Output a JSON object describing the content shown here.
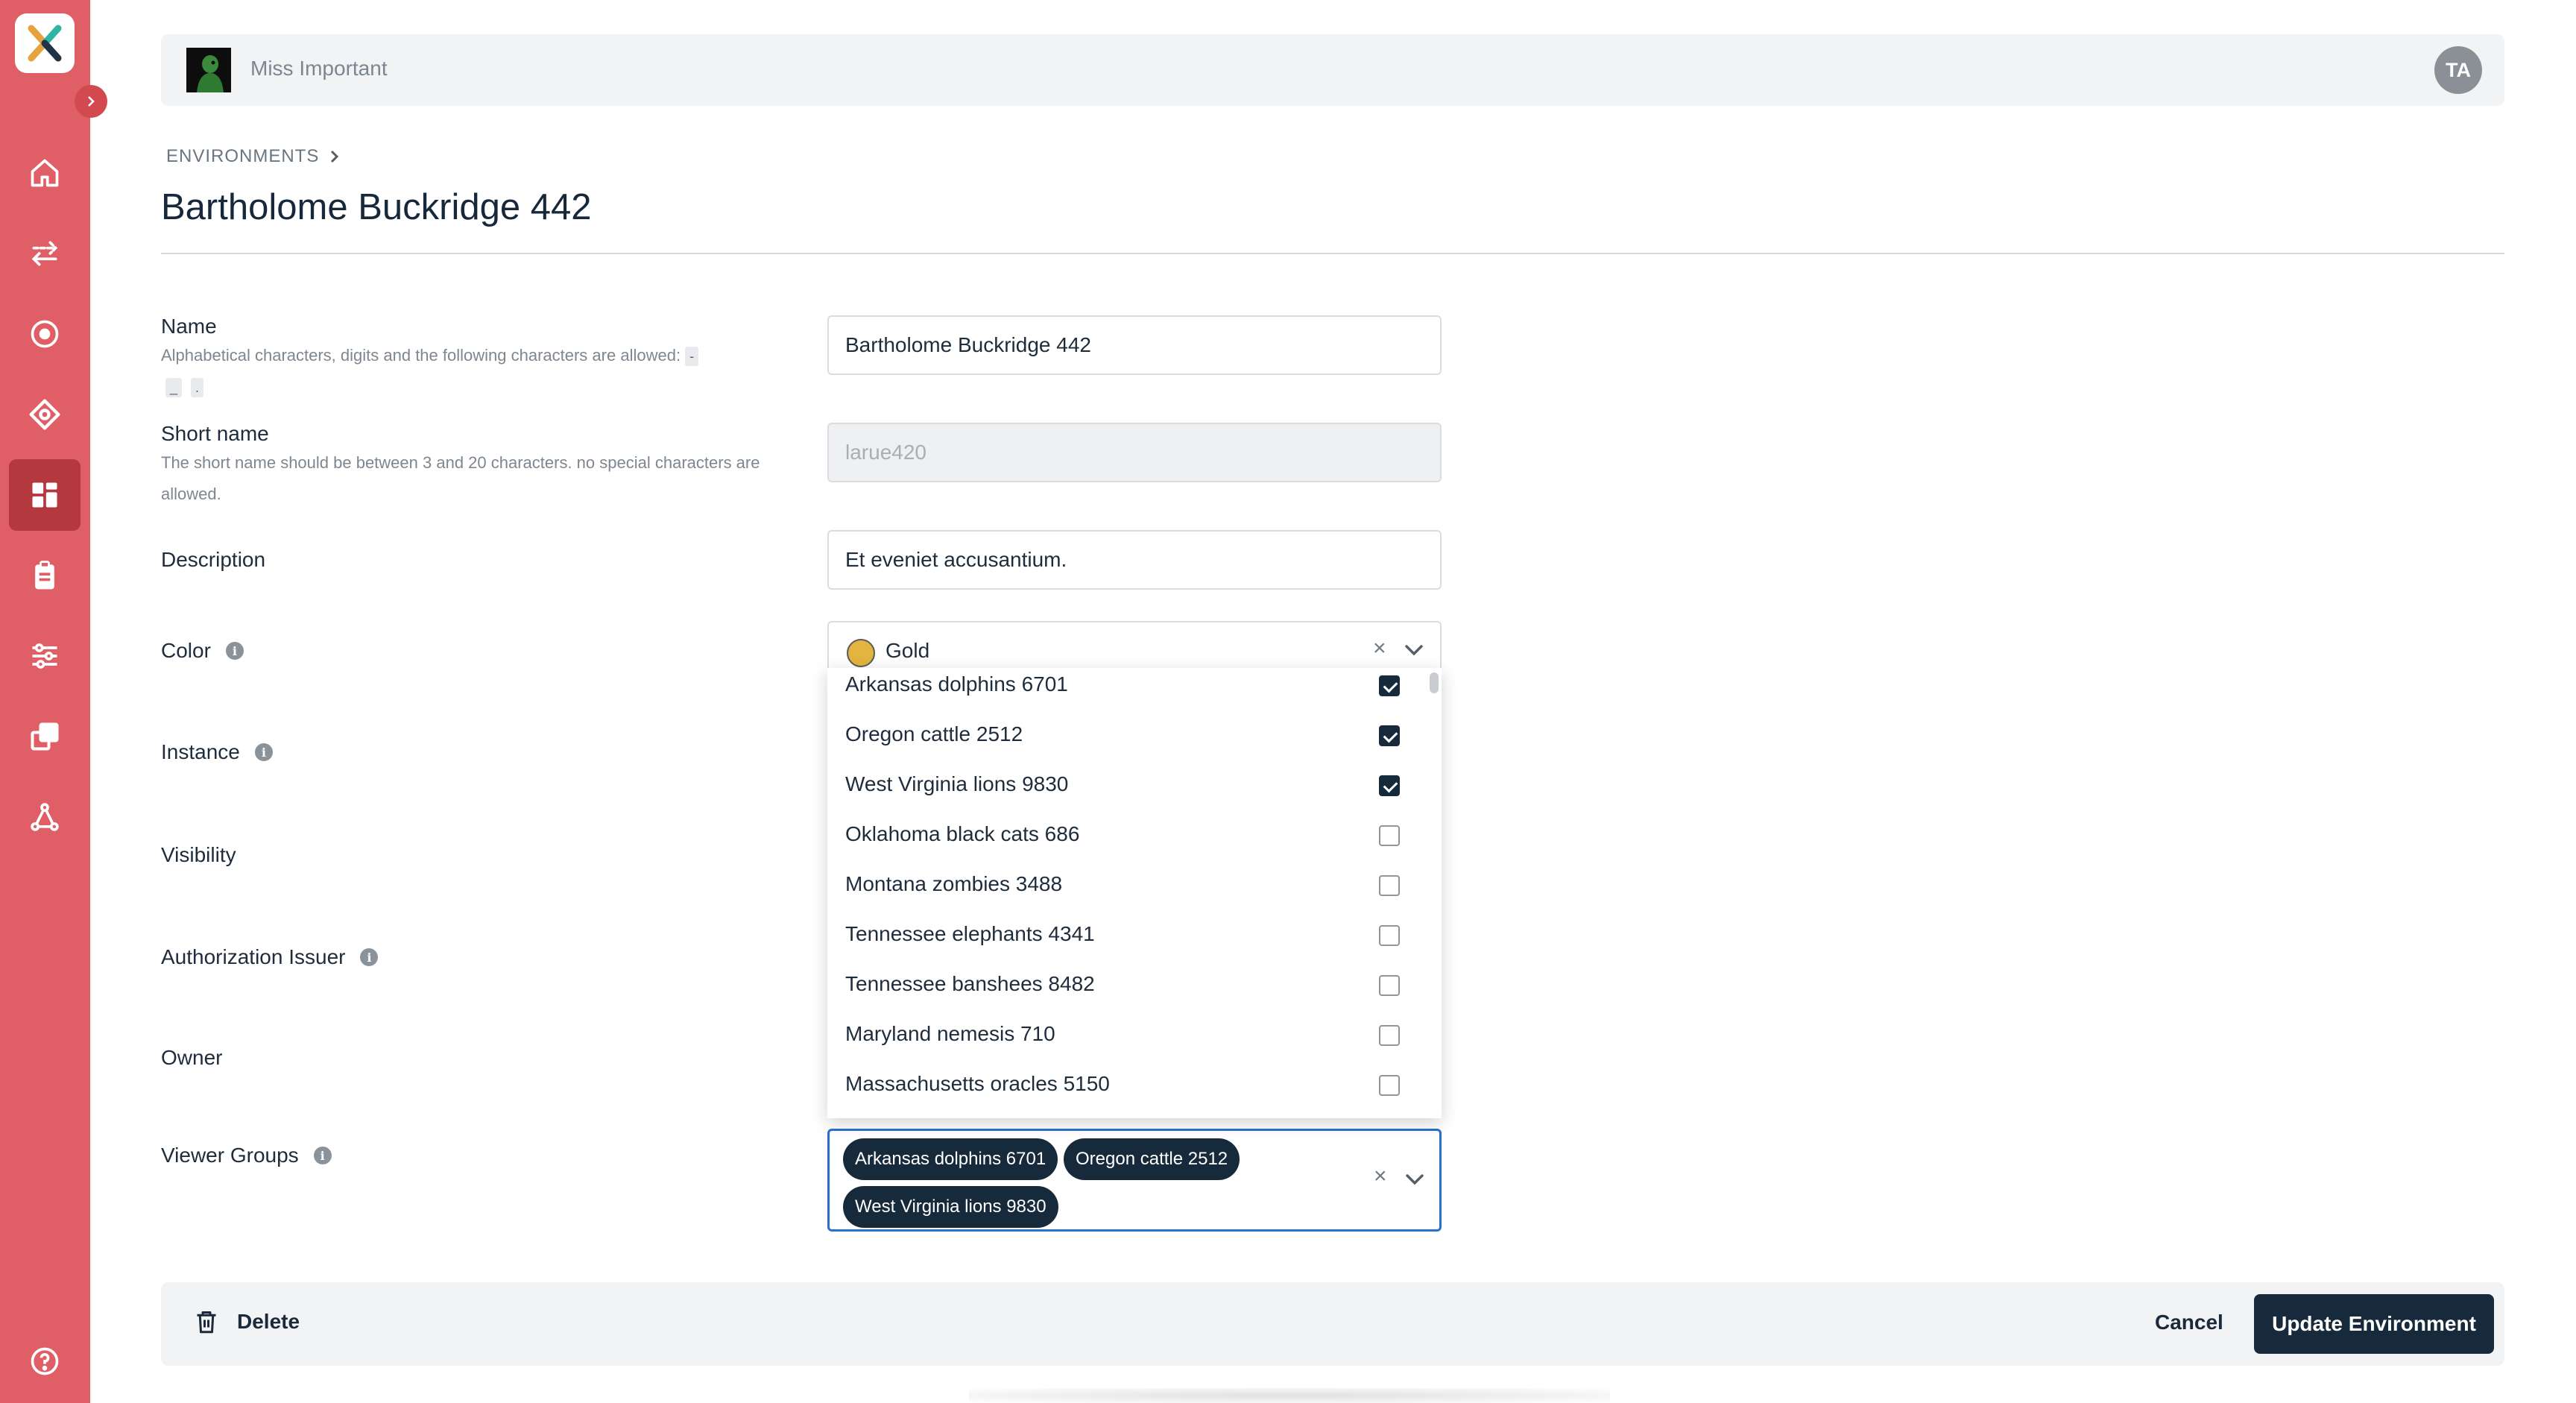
{
  "header": {
    "org_name": "Miss Important",
    "user_initials": "TA"
  },
  "breadcrumb": {
    "root": "ENVIRONMENTS"
  },
  "page": {
    "title": "Bartholome Buckridge 442"
  },
  "form": {
    "name": {
      "label": "Name",
      "hint": "Alphabetical characters, digits and the following characters are allowed:",
      "allowed_chars": [
        "-",
        "_",
        "."
      ],
      "value": "Bartholome Buckridge 442"
    },
    "short_name": {
      "label": "Short name",
      "hint": "The short name should be between 3 and 20 characters. no special characters are allowed.",
      "placeholder": "larue420"
    },
    "description": {
      "label": "Description",
      "value": "Et eveniet accusantium."
    },
    "color": {
      "label": "Color",
      "value": "Gold",
      "swatch": "#e3b43f"
    },
    "instance": {
      "label": "Instance"
    },
    "visibility": {
      "label": "Visibility"
    },
    "authorization_issuer": {
      "label": "Authorization Issuer"
    },
    "owner": {
      "label": "Owner"
    },
    "viewer_groups": {
      "label": "Viewer Groups",
      "selected": [
        "Arkansas dolphins 6701",
        "Oregon cattle 2512",
        "West Virginia lions 9830"
      ]
    }
  },
  "dropdown": {
    "options": [
      {
        "label": "Arkansas dolphins 6701",
        "checked": true
      },
      {
        "label": "Oregon cattle 2512",
        "checked": true
      },
      {
        "label": "West Virginia lions 9830",
        "checked": true
      },
      {
        "label": "Oklahoma black cats 686",
        "checked": false
      },
      {
        "label": "Montana zombies 3488",
        "checked": false
      },
      {
        "label": "Tennessee elephants 4341",
        "checked": false
      },
      {
        "label": "Tennessee banshees 8482",
        "checked": false
      },
      {
        "label": "Maryland nemesis 710",
        "checked": false
      },
      {
        "label": "Massachusetts oracles 5150",
        "checked": false
      }
    ]
  },
  "footer": {
    "delete_label": "Delete",
    "cancel_label": "Cancel",
    "update_label": "Update Environment"
  },
  "icons": {
    "sidebar": [
      "home-icon",
      "transfer-icon",
      "target-icon",
      "diamond-icon",
      "dashboard-icon",
      "clipboard-icon",
      "sliders-icon",
      "copy-icon",
      "network-icon",
      "help-icon"
    ]
  },
  "colors": {
    "sidebar": "#e05f66",
    "sidebar_active": "#b6383f",
    "primary_dark": "#172a3c",
    "focus_border": "#2a6fd0"
  }
}
